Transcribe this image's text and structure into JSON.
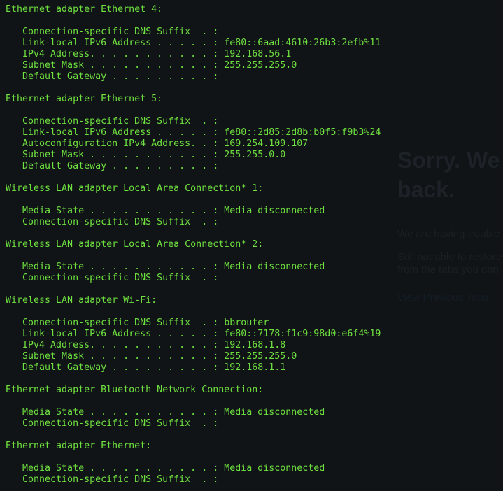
{
  "background_page": {
    "title_line1": "Sorry. We",
    "title_line2": "back.",
    "paragraph1": "We are having trouble",
    "paragraph2_line1": "Still not able to restore",
    "paragraph2_line2": "from the tabs you don",
    "link": "View Previous Tabs"
  },
  "terminal": {
    "adapters": [
      {
        "header": "Ethernet adapter Ethernet 4:",
        "fields": [
          "   Connection-specific DNS Suffix  . :",
          "   Link-local IPv6 Address . . . . . : fe80::6aad:4610:26b3:2efb%11",
          "   IPv4 Address. . . . . . . . . . . : 192.168.56.1",
          "   Subnet Mask . . . . . . . . . . . : 255.255.255.0",
          "   Default Gateway . . . . . . . . . :"
        ]
      },
      {
        "header": "Ethernet adapter Ethernet 5:",
        "fields": [
          "   Connection-specific DNS Suffix  . :",
          "   Link-local IPv6 Address . . . . . : fe80::2d85:2d8b:b0f5:f9b3%24",
          "   Autoconfiguration IPv4 Address. . : 169.254.109.107",
          "   Subnet Mask . . . . . . . . . . . : 255.255.0.0",
          "   Default Gateway . . . . . . . . . :"
        ]
      },
      {
        "header": "Wireless LAN adapter Local Area Connection* 1:",
        "fields": [
          "   Media State . . . . . . . . . . . : Media disconnected",
          "   Connection-specific DNS Suffix  . :"
        ]
      },
      {
        "header": "Wireless LAN adapter Local Area Connection* 2:",
        "fields": [
          "   Media State . . . . . . . . . . . : Media disconnected",
          "   Connection-specific DNS Suffix  . :"
        ]
      },
      {
        "header": "Wireless LAN adapter Wi-Fi:",
        "fields": [
          "   Connection-specific DNS Suffix  . : bbrouter",
          "   Link-local IPv6 Address . . . . . : fe80::7178:f1c9:98d0:e6f4%19",
          "   IPv4 Address. . . . . . . . . . . : 192.168.1.8",
          "   Subnet Mask . . . . . . . . . . . : 255.255.255.0",
          "   Default Gateway . . . . . . . . . : 192.168.1.1"
        ]
      },
      {
        "header": "Ethernet adapter Bluetooth Network Connection:",
        "fields": [
          "   Media State . . . . . . . . . . . : Media disconnected",
          "   Connection-specific DNS Suffix  . :"
        ]
      },
      {
        "header": "Ethernet adapter Ethernet:",
        "fields": [
          "   Media State . . . . . . . . . . . : Media disconnected",
          "   Connection-specific DNS Suffix  . :"
        ]
      }
    ]
  },
  "colors": {
    "terminal_text": "#6ee03f",
    "background": "#111417"
  }
}
